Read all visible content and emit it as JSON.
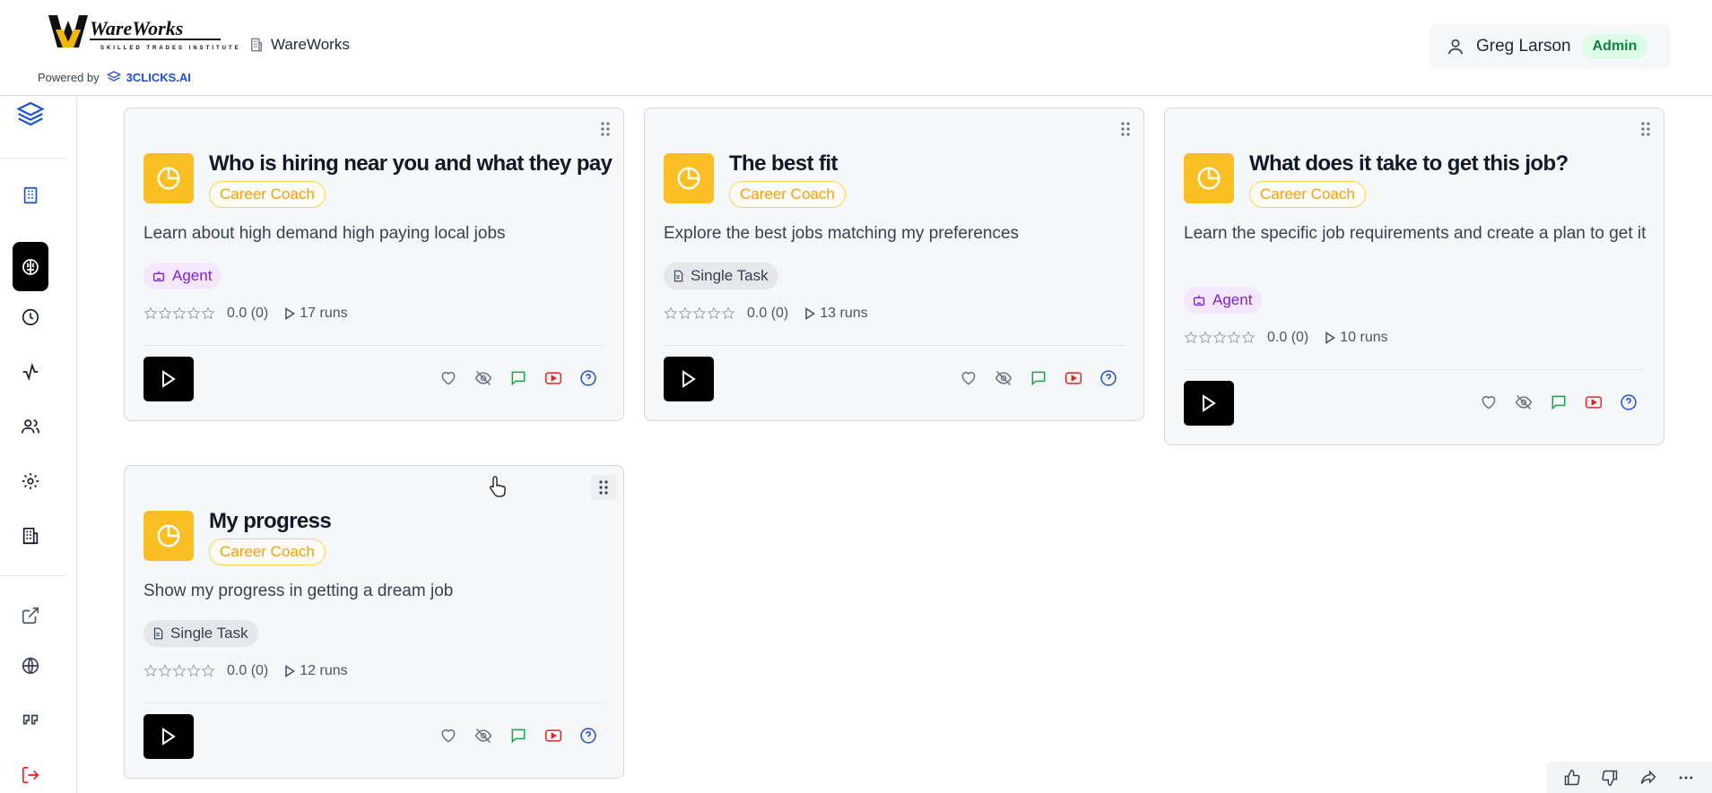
{
  "header": {
    "logo_text": "WareWorks",
    "logo_subtext": "SKILLED TRADES INSTITUTE",
    "org_name": "WareWorks",
    "powered_by_label": "Powered by",
    "powered_by_brand": "3CLICKS.AI",
    "user_name": "Greg Larson",
    "user_role": "Admin"
  },
  "sidebar": {
    "items": [
      {
        "icon": "layers-icon"
      },
      {
        "icon": "building-icon"
      },
      {
        "icon": "brain-icon",
        "active": true
      },
      {
        "icon": "clock-icon"
      },
      {
        "icon": "activity-icon"
      },
      {
        "icon": "users-icon"
      },
      {
        "icon": "gear-icon"
      },
      {
        "icon": "office-building-icon"
      },
      {
        "icon": "external-link-icon"
      },
      {
        "icon": "globe-icon"
      },
      {
        "icon": "quote-icon"
      },
      {
        "icon": "logout-icon"
      }
    ]
  },
  "cards": [
    {
      "title": "Who is hiring near you and what they pay",
      "category": "Career Coach",
      "description": "Learn about high demand high paying local jobs",
      "type": "Agent",
      "rating": "0.0 (0)",
      "runs": "17 runs"
    },
    {
      "title": "The best fit",
      "category": "Career Coach",
      "description": "Explore the best jobs matching my preferences",
      "type": "Single Task",
      "rating": "0.0 (0)",
      "runs": "13 runs"
    },
    {
      "title": "What does it take to get this job?",
      "category": "Career Coach",
      "description": "Learn the specific job requirements and create a plan to get it",
      "type": "Agent",
      "rating": "0.0 (0)",
      "runs": "10 runs"
    },
    {
      "title": "My progress",
      "category": "Career Coach",
      "description": "Show my progress in getting a dream job",
      "type": "Single Task",
      "rating": "0.0 (0)",
      "runs": "12 runs"
    }
  ],
  "colors": {
    "accent_yellow": "#fbbf24",
    "agent_purple": "#7e22ce",
    "admin_green": "#15803d",
    "chat_green": "#16a34a",
    "video_red": "#dc2626",
    "help_blue": "#1d4ed8"
  }
}
